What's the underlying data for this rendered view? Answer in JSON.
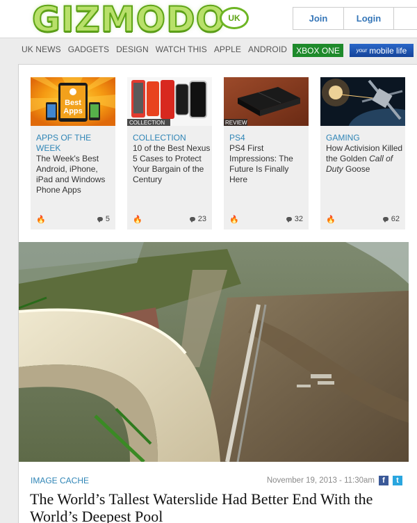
{
  "header": {
    "logo": "GIZMODO",
    "edition": "UK",
    "join_label": "Join",
    "login_label": "Login"
  },
  "nav": {
    "items": [
      "UK NEWS",
      "GADGETS",
      "DESIGN",
      "WATCH THIS",
      "APPLE",
      "ANDROID"
    ],
    "xbox_label": "XBOX ONE",
    "mobile_your": "your",
    "mobile_label": "mobile life"
  },
  "cards": [
    {
      "category": "APPS OF THE WEEK",
      "image_label": "Best Apps",
      "title": "The Week's Best Android, iPhone, iPad and Windows Phone Apps",
      "comments": "5"
    },
    {
      "category": "COLLECTION",
      "image_label": "COLLECTION",
      "title": "10 of the Best Nexus 5 Cases to Protect Your Bargain of the Century",
      "comments": "23"
    },
    {
      "category": "PS4",
      "image_label": "REVIEW",
      "title": "PS4 First Impressions: The Future Is Finally Here",
      "comments": "32"
    },
    {
      "category": "GAMING",
      "title_pre": "How Activision Killed the Golden",
      "title_em": "Call of Duty",
      "title_post": "Goose",
      "comments": "62"
    }
  ],
  "article": {
    "category": "IMAGE CACHE",
    "date": "November 19, 2013 - 11:30am",
    "headline": "The World’s Tallest Waterslide Had Better End With the World’s Deepest Pool"
  },
  "colors": {
    "link_blue": "#2f85b6",
    "logo_green": "#5ea416",
    "xbox_green": "#1e8a2b",
    "mobile_blue": "#15449a",
    "flame": "#e24a1a"
  }
}
